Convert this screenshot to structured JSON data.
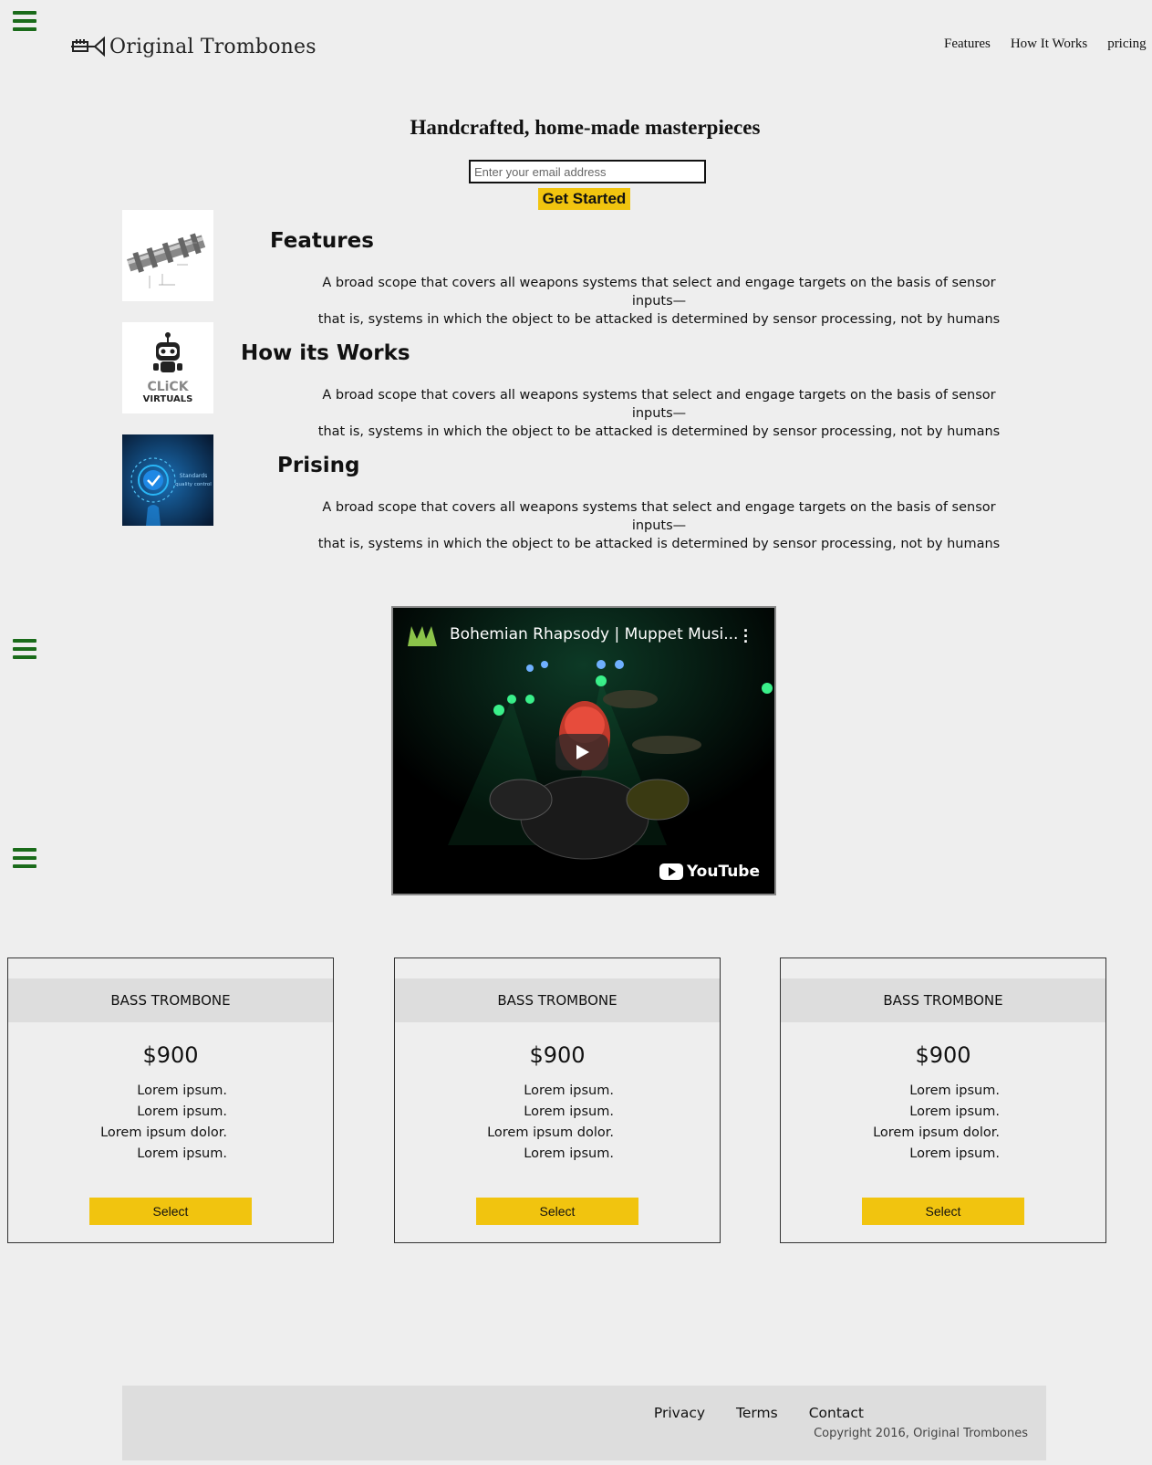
{
  "brand": {
    "name": "Original Trombones"
  },
  "nav": {
    "features": "Features",
    "how": "How It Works",
    "pricing": "pricing"
  },
  "hero": {
    "title": "Handcrafted, home-made masterpieces",
    "email_placeholder": "Enter your email address",
    "cta_label": "Get Started"
  },
  "features": [
    {
      "title": "Features",
      "desc_line1": "A broad scope that covers all weapons systems that select and engage targets on the basis of sensor inputs—",
      "desc_line2": "that is, systems in which the object to be attacked is determined by sensor processing, not by humans"
    },
    {
      "title": "How its Works",
      "desc_line1": "A broad scope that covers all weapons systems that select and engage targets on the basis of sensor inputs—",
      "desc_line2": "that is, systems in which the object to be attacked is determined by sensor processing, not by humans"
    },
    {
      "title": "Prising",
      "desc_line1": "A broad scope that covers all weapons systems that select and engage targets on the basis of sensor inputs—",
      "desc_line2": "that is, systems in which the object to be attacked is determined by sensor processing, not by humans"
    }
  ],
  "feature_images": {
    "second_line1": "CLiCK",
    "second_line2": "VIRTUALS",
    "third_line1": "Standards",
    "third_line2": "quality control"
  },
  "video": {
    "title": "Bohemian Rhapsody | Muppet Musi...",
    "platform": "YouTube"
  },
  "pricing": [
    {
      "title": "BASS TROMBONE",
      "price": "$900",
      "items": [
        "Lorem ipsum.",
        "Lorem ipsum.",
        "Lorem ipsum dolor.",
        "Lorem ipsum."
      ],
      "button": "Select"
    },
    {
      "title": "BASS TROMBONE",
      "price": "$900",
      "items": [
        "Lorem ipsum.",
        "Lorem ipsum.",
        "Lorem ipsum dolor.",
        "Lorem ipsum."
      ],
      "button": "Select"
    },
    {
      "title": "BASS TROMBONE",
      "price": "$900",
      "items": [
        "Lorem ipsum.",
        "Lorem ipsum.",
        "Lorem ipsum dolor.",
        "Lorem ipsum."
      ],
      "button": "Select"
    }
  ],
  "footer": {
    "privacy": "Privacy",
    "terms": "Terms",
    "contact": "Contact",
    "copyright": "Copyright 2016, Original Trombones"
  },
  "colors": {
    "accent": "#f1c40f",
    "menu_icon": "#1a6b1a",
    "background": "#eeeeee",
    "panel": "#dddddd"
  },
  "icons": {
    "menu": "hamburger-menu-icon",
    "logo": "trumpet-logo-icon",
    "play": "play-icon",
    "video_menu": "more-vertical-icon"
  }
}
